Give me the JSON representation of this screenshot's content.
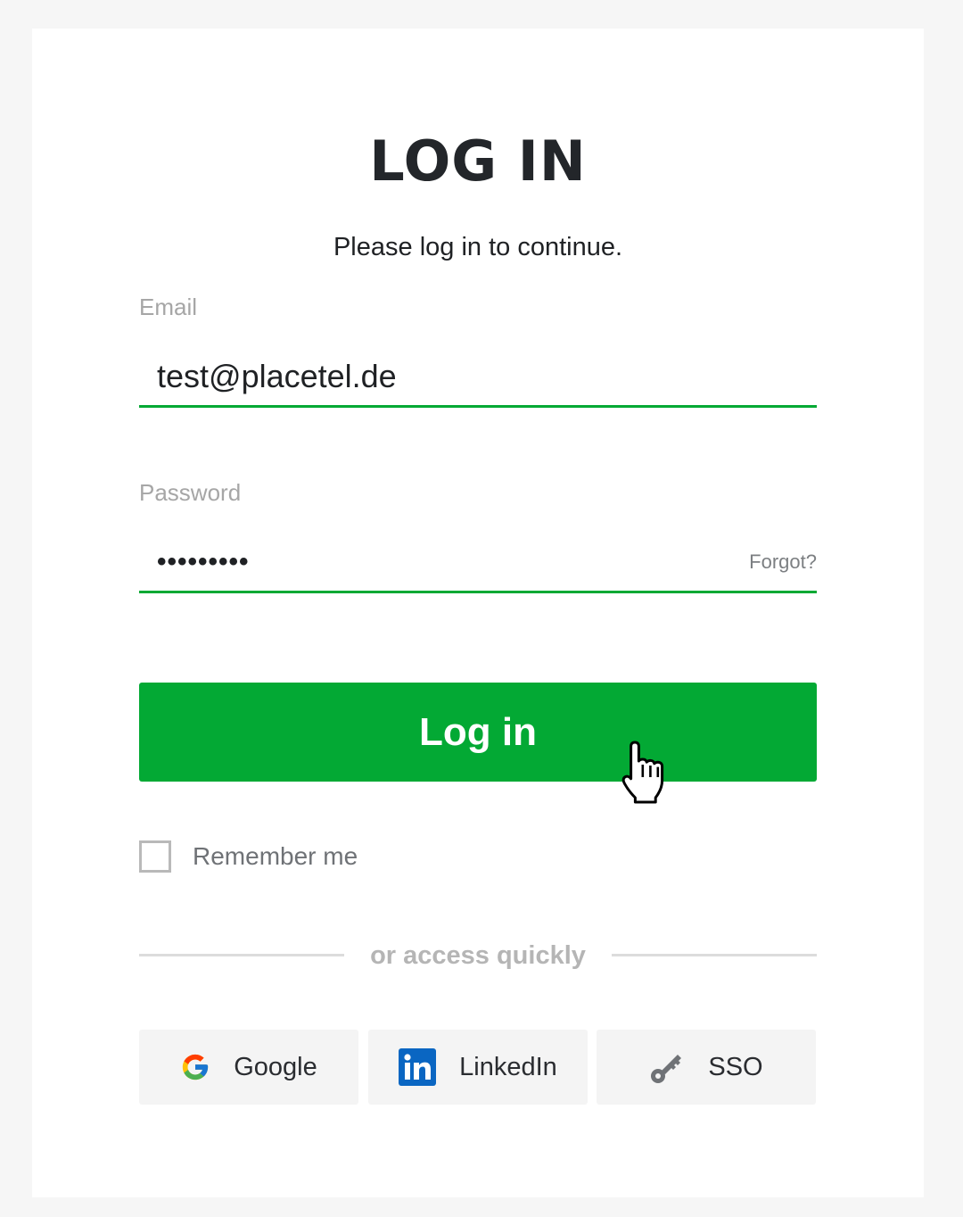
{
  "header": {
    "title": "LOG IN",
    "subtitle": "Please log in to continue."
  },
  "form": {
    "email": {
      "label": "Email",
      "value": "test@placetel.de"
    },
    "password": {
      "label": "Password",
      "value": "•••••••••",
      "forgot_label": "Forgot?"
    },
    "submit_label": "Log in",
    "remember_label": "Remember me",
    "remember_checked": false
  },
  "quick_access": {
    "divider_text": "or access quickly",
    "providers": [
      {
        "label": "Google",
        "icon": "google-icon"
      },
      {
        "label": "LinkedIn",
        "icon": "linkedin-icon"
      },
      {
        "label": "SSO",
        "icon": "key-icon"
      }
    ]
  },
  "colors": {
    "accent": "#03a934",
    "title": "#23262a",
    "linkedin": "#0a66c2"
  }
}
